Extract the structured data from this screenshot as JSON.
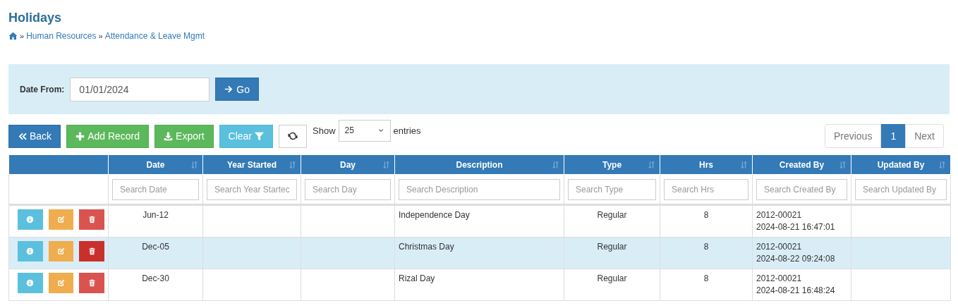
{
  "page_title": "Holidays",
  "breadcrumb": [
    {
      "label": "Human Resources"
    },
    {
      "label": "Attendance & Leave Mgmt"
    }
  ],
  "breadcrumb_separator": "»",
  "filter": {
    "label": "Date From:",
    "value": "01/01/2024",
    "button": "Go"
  },
  "toolbar": {
    "back": "Back",
    "add": "Add Record",
    "export": "Export",
    "clear": "Clear",
    "show_label": "Show",
    "entries_value": "25",
    "entries_label": "entries"
  },
  "pagination": {
    "previous": "Previous",
    "next": "Next",
    "pages": [
      {
        "label": "1",
        "selected": true
      }
    ]
  },
  "table": {
    "columns": [
      {
        "label": "Date",
        "placeholder": "Search Date"
      },
      {
        "label": "Year Started",
        "placeholder": "Search Year Startec"
      },
      {
        "label": "Day",
        "placeholder": "Search Day"
      },
      {
        "label": "Description",
        "placeholder": "Search Description"
      },
      {
        "label": "Type",
        "placeholder": "Search Type"
      },
      {
        "label": "Hrs",
        "placeholder": "Search Hrs"
      },
      {
        "label": "Created By",
        "placeholder": "Search Created By"
      },
      {
        "label": "Updated By",
        "placeholder": "Search Updated By"
      }
    ],
    "rows": [
      {
        "date": "Jun-12",
        "description": "Independence Day",
        "type": "Regular",
        "hrs": "8",
        "created_by": "2012-00021",
        "created_at": "2024-08-21 16:47:01",
        "highlighted": false
      },
      {
        "date": "Dec-05",
        "description": "Christmas Day",
        "type": "Regular",
        "hrs": "8",
        "created_by": "2012-00021",
        "created_at": "2024-08-22 09:24:08",
        "highlighted": true
      },
      {
        "date": "Dec-30",
        "description": "Rizal Day",
        "type": "Regular",
        "hrs": "8",
        "created_by": "2012-00021",
        "created_at": "2024-08-21 16:48:24",
        "highlighted": false
      }
    ]
  }
}
